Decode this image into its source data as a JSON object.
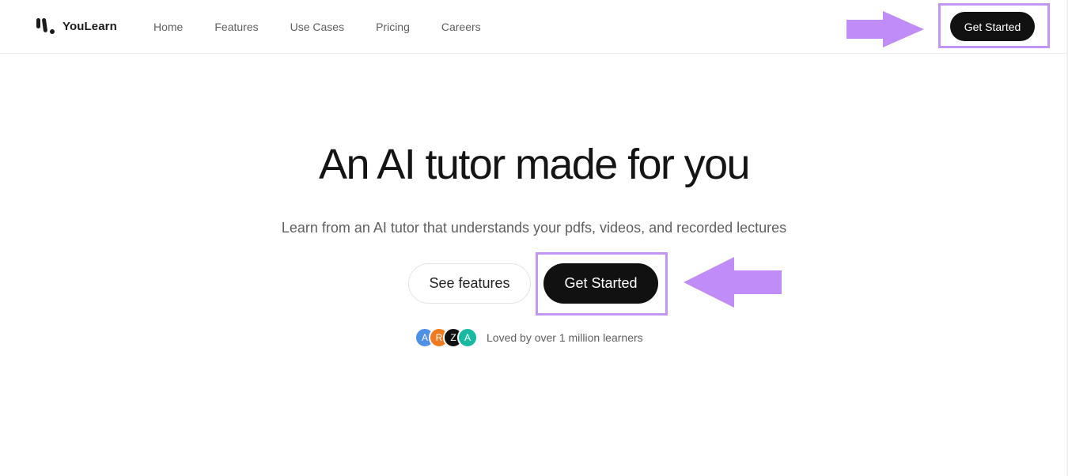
{
  "brand": {
    "name": "YouLearn"
  },
  "nav": {
    "links": [
      "Home",
      "Features",
      "Use Cases",
      "Pricing",
      "Careers"
    ],
    "cta_label": "Get Started"
  },
  "hero": {
    "title": "An AI tutor made for you",
    "subtitle": "Learn from an AI tutor that understands your pdfs, videos, and recorded lectures",
    "secondary_label": "See features",
    "primary_label": "Get Started"
  },
  "social_proof": {
    "avatars": [
      {
        "initial": "A",
        "color": "#4f8fe6"
      },
      {
        "initial": "R",
        "color": "#f07a1e"
      },
      {
        "initial": "Z",
        "color": "#111111"
      },
      {
        "initial": "A",
        "color": "#19b8a0"
      }
    ],
    "text": "Loved by over 1 million learners"
  },
  "colors": {
    "highlight": "#c396f6",
    "arrow": "#c08cf7",
    "button_dark": "#111111"
  },
  "icons": [
    "youlearn-logo-icon",
    "arrow-right-icon",
    "arrow-left-icon"
  ]
}
